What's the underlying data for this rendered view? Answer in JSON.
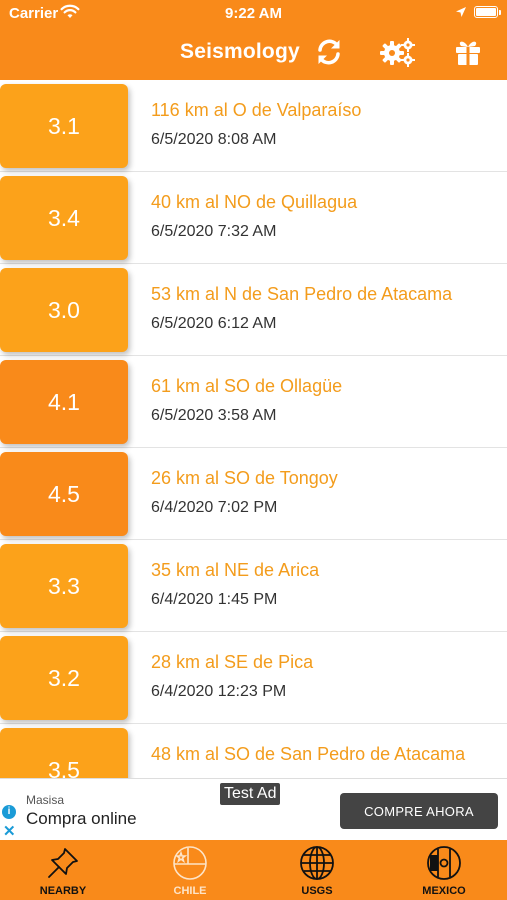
{
  "status_bar": {
    "carrier": "Carrier",
    "time": "9:22 AM"
  },
  "nav": {
    "title": "Seismology",
    "buttons": [
      "refresh-icon",
      "gears-icon",
      "gift-icon"
    ]
  },
  "colors": {
    "accent": "#f98a1a",
    "mag_low": "#fca21a",
    "mag_high": "#f98a1a",
    "place_text": "#f39c1c"
  },
  "events": [
    {
      "magnitude": "3.1",
      "place": "116 km al O de Valparaíso",
      "datetime": "6/5/2020 8:08 AM"
    },
    {
      "magnitude": "3.4",
      "place": "40 km al NO de Quillagua",
      "datetime": "6/5/2020 7:32 AM"
    },
    {
      "magnitude": "3.0",
      "place": "53 km al N de San Pedro de Atacama",
      "datetime": "6/5/2020 6:12 AM"
    },
    {
      "magnitude": "4.1",
      "place": "61 km al SO de Ollagüe",
      "datetime": "6/5/2020 3:58 AM"
    },
    {
      "magnitude": "4.5",
      "place": "26 km al SO de Tongoy",
      "datetime": "6/4/2020 7:02 PM"
    },
    {
      "magnitude": "3.3",
      "place": "35 km al NE de Arica",
      "datetime": "6/4/2020 1:45 PM"
    },
    {
      "magnitude": "3.2",
      "place": "28 km al SE de Pica",
      "datetime": "6/4/2020 12:23 PM"
    },
    {
      "magnitude": "3.5",
      "place": "48 km al SO de San Pedro de Atacama",
      "datetime": ""
    }
  ],
  "ad": {
    "tag": "Test Ad",
    "advertiser": "Masisa",
    "headline": "Compra online",
    "cta": "COMPRE AHORA"
  },
  "tabs": [
    {
      "label": "NEARBY",
      "icon": "pin-icon",
      "active": false
    },
    {
      "label": "CHILE",
      "icon": "chile-flag-icon",
      "active": true
    },
    {
      "label": "USGS",
      "icon": "globe-icon",
      "active": false
    },
    {
      "label": "MEXICO",
      "icon": "mexico-flag-icon",
      "active": false
    }
  ]
}
